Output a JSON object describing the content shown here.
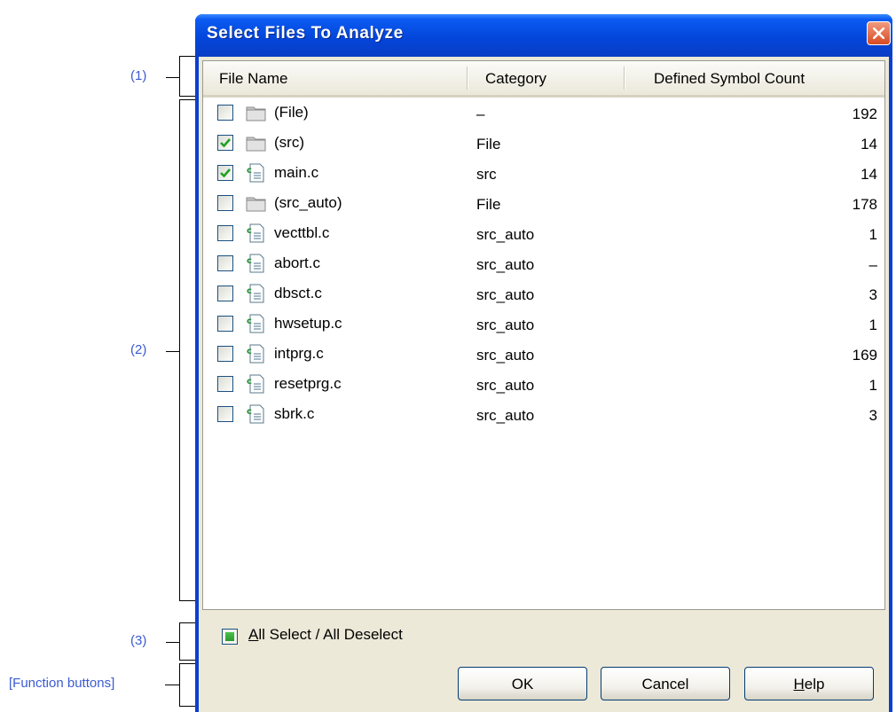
{
  "callouts": [
    {
      "label": "(1)"
    },
    {
      "label": "(2)"
    },
    {
      "label": "(3)"
    },
    {
      "label": "[Function buttons]"
    }
  ],
  "dialog": {
    "title": "Select Files To Analyze",
    "close_icon": "close-icon",
    "columns": [
      "File Name",
      "Category",
      "Defined Symbol Count"
    ],
    "rows": [
      {
        "name": "(File)",
        "category": "–",
        "count": "192",
        "checked": false,
        "icon": "folder-icon"
      },
      {
        "name": "(src)",
        "category": "File",
        "count": "14",
        "checked": true,
        "icon": "folder-icon"
      },
      {
        "name": "main.c",
        "category": "src",
        "count": "14",
        "checked": true,
        "icon": "c-file-icon"
      },
      {
        "name": "(src_auto)",
        "category": "File",
        "count": "178",
        "checked": false,
        "icon": "folder-icon"
      },
      {
        "name": "vecttbl.c",
        "category": "src_auto",
        "count": "1",
        "checked": false,
        "icon": "c-file-icon"
      },
      {
        "name": "abort.c",
        "category": "src_auto",
        "count": "–",
        "checked": false,
        "icon": "c-file-icon"
      },
      {
        "name": "dbsct.c",
        "category": "src_auto",
        "count": "3",
        "checked": false,
        "icon": "c-file-icon"
      },
      {
        "name": "hwsetup.c",
        "category": "src_auto",
        "count": "1",
        "checked": false,
        "icon": "c-file-icon"
      },
      {
        "name": "intprg.c",
        "category": "src_auto",
        "count": "169",
        "checked": false,
        "icon": "c-file-icon"
      },
      {
        "name": "resetprg.c",
        "category": "src_auto",
        "count": "1",
        "checked": false,
        "icon": "c-file-icon"
      },
      {
        "name": "sbrk.c",
        "category": "src_auto",
        "count": "3",
        "checked": false,
        "icon": "c-file-icon"
      }
    ],
    "all_select": {
      "mnemonic": "A",
      "rest": "ll Select / All Deselect",
      "state": "indeterminate"
    },
    "buttons": {
      "ok": "OK",
      "cancel": "Cancel",
      "help_mnemonic": "H",
      "help_rest": "elp"
    }
  },
  "colors": {
    "callout_text": "#3b5bd0",
    "titlebar": "#0346db",
    "client_bg": "#ece9d8",
    "check_green": "#21a121"
  }
}
